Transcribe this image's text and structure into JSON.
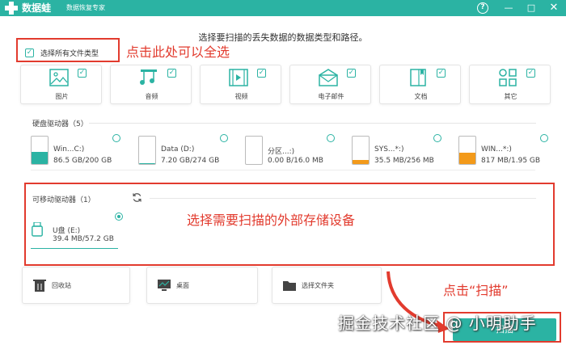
{
  "colors": {
    "accent": "#2bb3a3",
    "annotation": "#e23b2e",
    "drive_teal": "#2bb3a3",
    "drive_orange": "#f39a1a"
  },
  "titlebar": {
    "app_name": "数据蛙",
    "slogan": "数据恢复专家",
    "help_icon": "?",
    "min_icon": "—",
    "max_icon": "□",
    "close_icon": "✕"
  },
  "header": {
    "text": "选择要扫描的丢失数据的数据类型和路径。"
  },
  "select_all": {
    "label": "选择所有文件类型",
    "checked": true
  },
  "annotations": {
    "select_all_note": "点击此处可以全选",
    "external_note": "选择需要扫描的外部存储设备",
    "scan_note": "点击“扫描”"
  },
  "file_types": [
    {
      "label": "图片",
      "icon": "image-icon",
      "checked": true
    },
    {
      "label": "音频",
      "icon": "music-icon",
      "checked": true
    },
    {
      "label": "视频",
      "icon": "video-icon",
      "checked": true
    },
    {
      "label": "电子邮件",
      "icon": "email-icon",
      "checked": true
    },
    {
      "label": "文档",
      "icon": "document-icon",
      "checked": true
    },
    {
      "label": "其它",
      "icon": "others-icon",
      "checked": true
    }
  ],
  "hard_drives": {
    "title": "硬盘驱动器（5）",
    "items": [
      {
        "name": "Win...C:)",
        "size": "86.5 GB/200 GB",
        "fill": 0.43,
        "color": "#2bb3a3"
      },
      {
        "name": "Data (D:)",
        "size": "7.20 GB/274 GB",
        "fill": 0.03,
        "color": "#2bb3a3"
      },
      {
        "name": "分区...:)",
        "size": "0.00 B/16.0 MB",
        "fill": 0.0,
        "color": "#2bb3a3"
      },
      {
        "name": "SYS...*:)",
        "size": "35.5 MB/256 MB",
        "fill": 0.14,
        "color": "#f39a1a"
      },
      {
        "name": "WIN...*:)",
        "size": "817 MB/1.95 GB",
        "fill": 0.42,
        "color": "#f39a1a"
      }
    ]
  },
  "removable": {
    "title": "可移动驱动器（1）",
    "refresh_icon": "refresh-icon",
    "items": [
      {
        "name": "U盘 (E:)",
        "size": "39.4 MB/57.2 GB",
        "selected": true
      }
    ]
  },
  "locations": [
    {
      "label": "回收站",
      "icon": "trash-icon"
    },
    {
      "label": "桌面",
      "icon": "desktop-icon"
    },
    {
      "label": "选择文件夹",
      "icon": "folder-icon"
    }
  ],
  "scan_button": {
    "label": "扫描"
  },
  "watermark": "掘金技术社区 @ 小明助手"
}
